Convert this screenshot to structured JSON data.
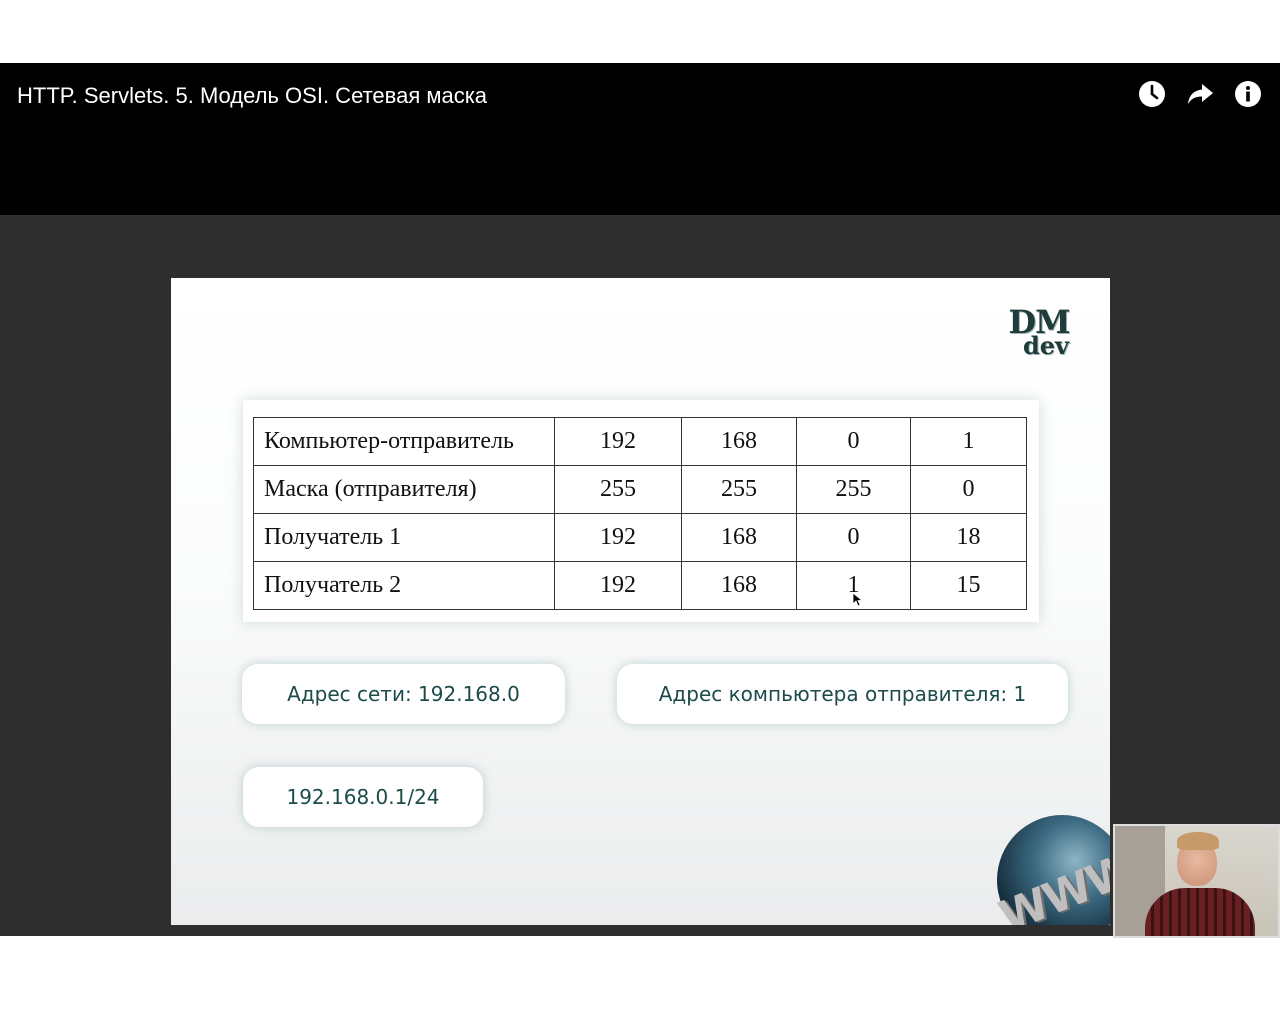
{
  "player": {
    "title": "HTTP. Servlets. 5. Модель OSI. Сетевая маска",
    "icons": [
      "watch-later-icon",
      "share-icon",
      "info-icon"
    ]
  },
  "slide": {
    "logo": {
      "top": "DM",
      "bottom": "dev"
    },
    "table": {
      "rows": [
        {
          "label": "Компьютер-отправитель",
          "octets": [
            "192",
            "168",
            "0",
            "1"
          ]
        },
        {
          "label": "Маска (отправителя)",
          "octets": [
            "255",
            "255",
            "255",
            "0"
          ]
        },
        {
          "label": "Получатель 1",
          "octets": [
            "192",
            "168",
            "0",
            "18"
          ]
        },
        {
          "label": "Получатель 2",
          "octets": [
            "192",
            "168",
            "1",
            "15"
          ]
        }
      ]
    },
    "network_address": "Адрес сети: 192.168.0",
    "host_address": "Адрес компьютера отправителя: 1",
    "cidr": "192.168.0.1/24",
    "globe_text": "WWW"
  },
  "colors": {
    "slide_text_teal": "#1d4a4a",
    "player_bg": "#000000",
    "frame_bg": "#2e2e2e"
  }
}
